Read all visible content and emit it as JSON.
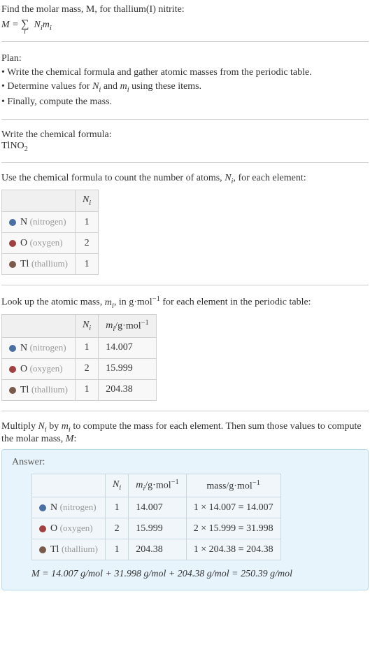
{
  "intro": {
    "line1": "Find the molar mass, M, for thallium(I) nitrite:",
    "formula_display": "M = ∑ Nᵢmᵢ",
    "formula_sub": "i"
  },
  "plan": {
    "heading": "Plan:",
    "b1": "• Write the chemical formula and gather atomic masses from the periodic table.",
    "b2": "• Determine values for Nᵢ and mᵢ using these items.",
    "b3": "• Finally, compute the mass."
  },
  "chem_formula": {
    "heading": "Write the chemical formula:",
    "value": "TlNO",
    "sub": "2"
  },
  "count_section": {
    "heading_a": "Use the chemical formula to count the number of atoms, ",
    "heading_ni": "Nᵢ",
    "heading_b": ", for each element:"
  },
  "table1": {
    "header_ni": "Nᵢ",
    "rows": [
      {
        "dot": "dot-n",
        "sym": "N",
        "label": "(nitrogen)",
        "ni": "1"
      },
      {
        "dot": "dot-o",
        "sym": "O",
        "label": "(oxygen)",
        "ni": "2"
      },
      {
        "dot": "dot-tl",
        "sym": "Tl",
        "label": "(thallium)",
        "ni": "1"
      }
    ]
  },
  "mass_section": {
    "heading_a": "Look up the atomic mass, ",
    "heading_mi": "mᵢ",
    "heading_b": ", in g·mol",
    "heading_sup": "−1",
    "heading_c": " for each element in the periodic table:"
  },
  "table2": {
    "header_ni": "Nᵢ",
    "header_mi": "mᵢ/g·mol⁻¹",
    "rows": [
      {
        "dot": "dot-n",
        "sym": "N",
        "label": "(nitrogen)",
        "ni": "1",
        "mi": "14.007"
      },
      {
        "dot": "dot-o",
        "sym": "O",
        "label": "(oxygen)",
        "ni": "2",
        "mi": "15.999"
      },
      {
        "dot": "dot-tl",
        "sym": "Tl",
        "label": "(thallium)",
        "ni": "1",
        "mi": "204.38"
      }
    ]
  },
  "multiply_section": {
    "text_a": "Multiply ",
    "ni": "Nᵢ",
    "text_b": " by ",
    "mi": "mᵢ",
    "text_c": " to compute the mass for each element. Then sum those values to compute the molar mass, ",
    "m": "M",
    "text_d": ":"
  },
  "answer": {
    "label": "Answer:",
    "header_ni": "Nᵢ",
    "header_mi": "mᵢ/g·mol⁻¹",
    "header_mass": "mass/g·mol⁻¹",
    "rows": [
      {
        "dot": "dot-n",
        "sym": "N",
        "label": "(nitrogen)",
        "ni": "1",
        "mi": "14.007",
        "mass": "1 × 14.007 = 14.007"
      },
      {
        "dot": "dot-o",
        "sym": "O",
        "label": "(oxygen)",
        "ni": "2",
        "mi": "15.999",
        "mass": "2 × 15.999 = 31.998"
      },
      {
        "dot": "dot-tl",
        "sym": "Tl",
        "label": "(thallium)",
        "ni": "1",
        "mi": "204.38",
        "mass": "1 × 204.38 = 204.38"
      }
    ],
    "final": "M = 14.007 g/mol + 31.998 g/mol + 204.38 g/mol = 250.39 g/mol"
  }
}
